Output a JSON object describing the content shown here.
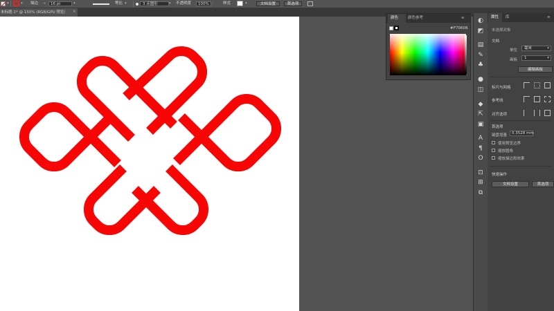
{
  "control_bar": {
    "stroke_label": "描边",
    "stroke_value": "16 pt",
    "stroke_profile": "等比",
    "brush_label": "3 点圆形",
    "opacity_label": "不透明度",
    "opacity_value": "100%",
    "style_label": "样式",
    "doc_setup_button": "文档设置",
    "preferences_button": "首选项"
  },
  "document_tab": {
    "title": "未标题-1* @ 150% (RGB/GPU 预览)"
  },
  "color_panel": {
    "tab_color": "颜色",
    "tab_color_guide": "颜色参考",
    "hex_symbol": "#",
    "hex_value": "F70606"
  },
  "properties_panel": {
    "tab_properties": "属性",
    "tab_layers": "库",
    "no_selection": "未选择对象",
    "document_label": "文档",
    "units_label": "单位",
    "units_value": "毫米",
    "artboard_label": "画板",
    "artboard_value": "1",
    "edit_artboards_button": "编辑画板",
    "rulers_grids_label": "标尺与网格",
    "guides_label": "参考线",
    "align_label": "对齐选项",
    "preferences_label": "首选项",
    "keyboard_increment_label": "键盘增量",
    "keyboard_increment_value": "0.3528 mm",
    "use_preview_bounds": "使用预览边界",
    "scale_corners": "缩放圆角",
    "scale_strokes_effects": "缩放描边和效果",
    "quick_actions_label": "快速操作",
    "doc_setup_button": "文档设置",
    "preferences_button": "首选项"
  },
  "colors": {
    "knot": "#F70606",
    "canvas_bg": "#535353",
    "panel_bg": "#424242"
  }
}
